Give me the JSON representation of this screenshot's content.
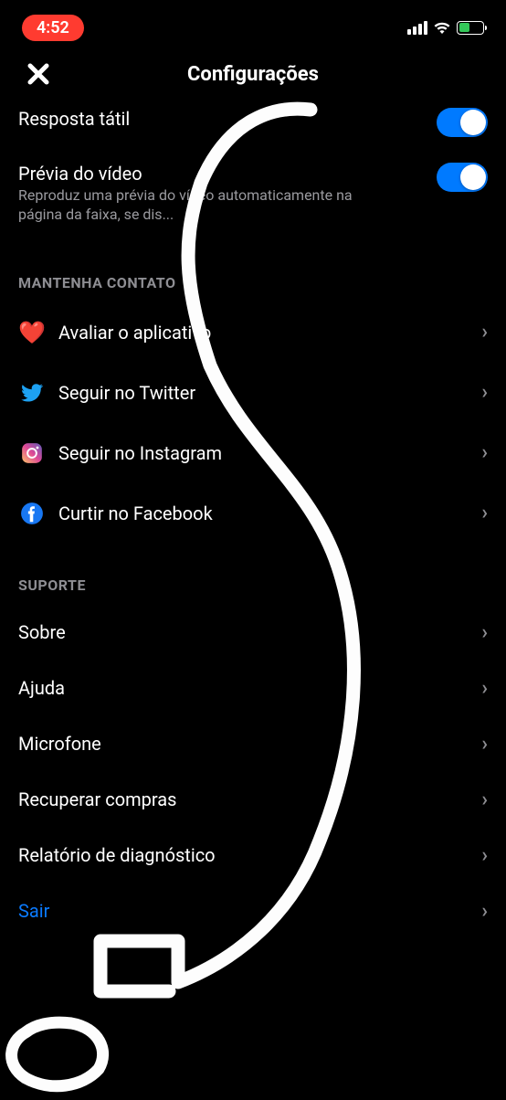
{
  "status": {
    "time": "4:52"
  },
  "header": {
    "title": "Configurações"
  },
  "settings": [
    {
      "key": "haptic",
      "title": "Resposta tátil",
      "subtitle": "",
      "on": true
    },
    {
      "key": "video_preview",
      "title": "Prévia do vídeo",
      "subtitle": "Reproduz uma prévia do vídeo automaticamente na página da faixa, se dis...",
      "on": true
    }
  ],
  "sections": [
    {
      "key": "contact",
      "title": "MANTENHA CONTATO",
      "items": [
        {
          "key": "rate",
          "icon": "heart",
          "label": "Avaliar o aplicativo"
        },
        {
          "key": "twitter",
          "icon": "twitter",
          "label": "Seguir no Twitter"
        },
        {
          "key": "instagram",
          "icon": "instagram",
          "label": "Seguir no Instagram"
        },
        {
          "key": "facebook",
          "icon": "facebook",
          "label": "Curtir no Facebook"
        }
      ]
    },
    {
      "key": "support",
      "title": "SUPORTE",
      "items": [
        {
          "key": "about",
          "icon": "",
          "label": "Sobre"
        },
        {
          "key": "help",
          "icon": "",
          "label": "Ajuda"
        },
        {
          "key": "mic",
          "icon": "",
          "label": "Microfone"
        },
        {
          "key": "restore",
          "icon": "",
          "label": "Recuperar compras"
        },
        {
          "key": "diag",
          "icon": "",
          "label": "Relatório de diagnóstico"
        },
        {
          "key": "logout",
          "icon": "",
          "label": "Sair",
          "style": "link"
        }
      ]
    }
  ]
}
